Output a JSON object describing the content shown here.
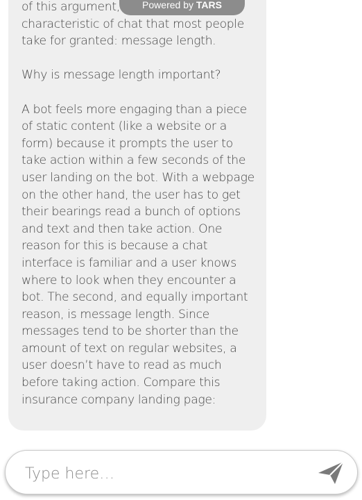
{
  "badge": {
    "prefix": "Powered by",
    "brand": "TARS"
  },
  "message": {
    "text": "of this argument, I will examine one characteristic of chat that most people take for granted: message length.\n\nWhy is message length important?\n\nA bot feels more engaging than a piece of static content (like a website or a form) because it prompts the user to take action within a few seconds of the user landing on the bot. With a webpage on the other hand, the user has to get their bearings read a bunch of options and text and then take action. One reason for this is because a chat interface is familiar and a user knows where to look when they encounter a bot. The second, and equally important reason, is message length. Since messages tend to be shorter than the amount of text on regular websites, a user doesn’t have to read as much before taking action. Compare this insurance company landing page:"
  },
  "composer": {
    "placeholder": "Type here…",
    "send_icon": "paper-plane-icon"
  },
  "colors": {
    "bubble_bg": "#efefef",
    "badge_bg": "#8c8c8c",
    "text": "#454545",
    "send_icon": "#7a7a7a"
  }
}
